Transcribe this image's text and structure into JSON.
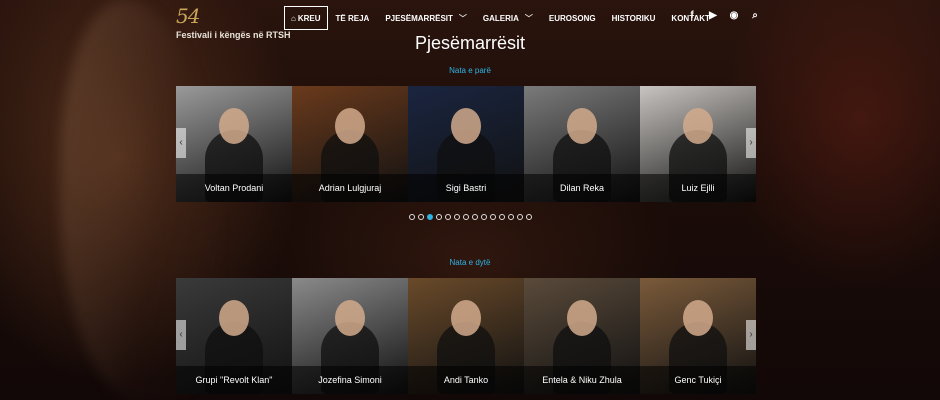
{
  "header": {
    "logo_mark": "54",
    "logo_text": "Festivali i këngës në RTSH",
    "nav": [
      {
        "label": "KREU",
        "icon": "home-icon",
        "active": true
      },
      {
        "label": "TË REJA"
      },
      {
        "label": "PJESËMARRËSIT",
        "caret": true
      },
      {
        "label": "GALERIA",
        "caret": true
      },
      {
        "label": "EUROSONG"
      },
      {
        "label": "HISTORIKU"
      },
      {
        "label": "KONTAKT"
      }
    ],
    "social": [
      {
        "name": "facebook-icon",
        "glyph": "f"
      },
      {
        "name": "youtube-icon",
        "glyph": "▶"
      },
      {
        "name": "rss-icon",
        "glyph": "◉"
      },
      {
        "name": "search-icon",
        "glyph": "⌕"
      }
    ]
  },
  "page_title": "Pjesëmarrësit",
  "sections": [
    {
      "label": "Nata e parë",
      "cards": [
        {
          "name": "Voltan Prodani",
          "bg": "#9a9a9a"
        },
        {
          "name": "Adrian Lulgjuraj",
          "bg": "#6a3a1c"
        },
        {
          "name": "Sigi Bastri",
          "bg": "#1a2540"
        },
        {
          "name": "Dilan Reka",
          "bg": "#7a7a7a"
        },
        {
          "name": "Luiz Ejlli",
          "bg": "#c8c4c0"
        }
      ]
    },
    {
      "label": "Nata e dytë",
      "cards": [
        {
          "name": "Grupi \"Revolt Klan\"",
          "bg": "#3a3a3a"
        },
        {
          "name": "Jozefina Simoni",
          "bg": "#8a8a8a"
        },
        {
          "name": "Andi Tanko",
          "bg": "#6a4a2a"
        },
        {
          "name": "Entela & Niku Zhula",
          "bg": "#5a4a3a"
        },
        {
          "name": "Genc Tukiçi",
          "bg": "#7a5a3a"
        }
      ]
    }
  ],
  "carousel": {
    "page_count": 14,
    "active_page": 3,
    "prev_glyph": "‹",
    "next_glyph": "›"
  }
}
